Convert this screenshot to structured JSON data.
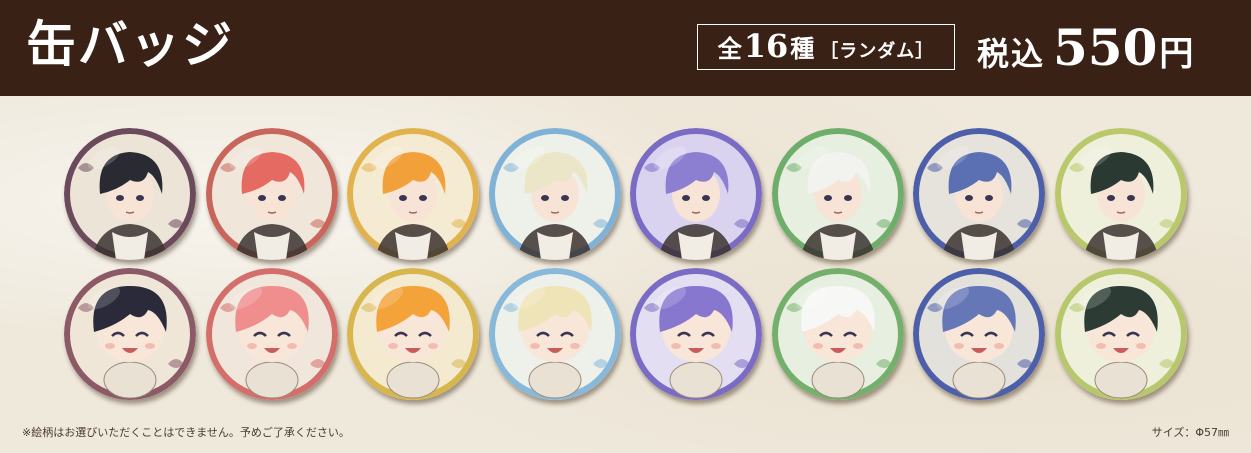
{
  "header": {
    "title": "缶バッジ",
    "count_prefix": "全",
    "count_number": "16",
    "count_suffix": "種",
    "count_note": "［ランダム］",
    "price_prefix": "税込",
    "price_value": "550",
    "price_unit": "円",
    "background_color": "#3a2116"
  },
  "badges": [
    {
      "row": 1,
      "hair": "#2a2a33",
      "rim": "#6b4a5c",
      "bg": "#ece4d6",
      "style": "portrait",
      "icon": "badge-portrait-icon"
    },
    {
      "row": 1,
      "hair": "#e46a62",
      "rim": "#c9665c",
      "bg": "#f0e6da",
      "style": "portrait",
      "icon": "badge-portrait-icon"
    },
    {
      "row": 1,
      "hair": "#f2a13a",
      "rim": "#e1b24d",
      "bg": "#f5ead2",
      "style": "portrait",
      "icon": "badge-portrait-icon"
    },
    {
      "row": 1,
      "hair": "#ece6c8",
      "rim": "#7fb2d6",
      "bg": "#eef1ea",
      "style": "portrait",
      "icon": "badge-portrait-icon"
    },
    {
      "row": 1,
      "hair": "#8c7fd1",
      "rim": "#7a6bc4",
      "bg": "#d9d3ef",
      "style": "portrait",
      "icon": "badge-portrait-icon"
    },
    {
      "row": 1,
      "hair": "#f2f2ee",
      "rim": "#6fae6a",
      "bg": "#e6efe0",
      "style": "portrait",
      "icon": "badge-portrait-icon"
    },
    {
      "row": 1,
      "hair": "#5b6fb3",
      "rim": "#4d5fa8",
      "bg": "#e6e2dc",
      "style": "portrait",
      "icon": "badge-portrait-icon"
    },
    {
      "row": 1,
      "hair": "#2a3a33",
      "rim": "#b8c86a",
      "bg": "#eef0dc",
      "style": "portrait",
      "icon": "badge-portrait-icon"
    },
    {
      "row": 2,
      "hair": "#2a2a3a",
      "rim": "#8b5a66",
      "bg": "#efe6d8",
      "style": "chibi",
      "icon": "badge-chibi-icon"
    },
    {
      "row": 2,
      "hair": "#f08e8e",
      "rim": "#d46e6a",
      "bg": "#f1e6dc",
      "style": "chibi",
      "icon": "badge-chibi-icon"
    },
    {
      "row": 2,
      "hair": "#f4a23a",
      "rim": "#d8b64e",
      "bg": "#f3ead0",
      "style": "chibi",
      "icon": "badge-chibi-icon"
    },
    {
      "row": 2,
      "hair": "#efe3b8",
      "rim": "#88b9db",
      "bg": "#eef0ea",
      "style": "chibi",
      "icon": "badge-chibi-icon"
    },
    {
      "row": 2,
      "hair": "#8877cf",
      "rim": "#7a6bc4",
      "bg": "#e3def2",
      "style": "chibi",
      "icon": "badge-chibi-icon"
    },
    {
      "row": 2,
      "hair": "#f7f7f5",
      "rim": "#74b06c",
      "bg": "#e6efe0",
      "style": "chibi",
      "icon": "badge-chibi-icon"
    },
    {
      "row": 2,
      "hair": "#6677b8",
      "rim": "#4e5fa9",
      "bg": "#e3e1dc",
      "style": "chibi",
      "icon": "badge-chibi-icon"
    },
    {
      "row": 2,
      "hair": "#2c3c34",
      "rim": "#b7c76b",
      "bg": "#eef0dc",
      "style": "chibi",
      "icon": "badge-chibi-icon"
    }
  ],
  "footer": {
    "note": "※絵柄はお選びいただくことはできません。予めご了承ください。",
    "size": "サイズ：Φ57㎜"
  }
}
